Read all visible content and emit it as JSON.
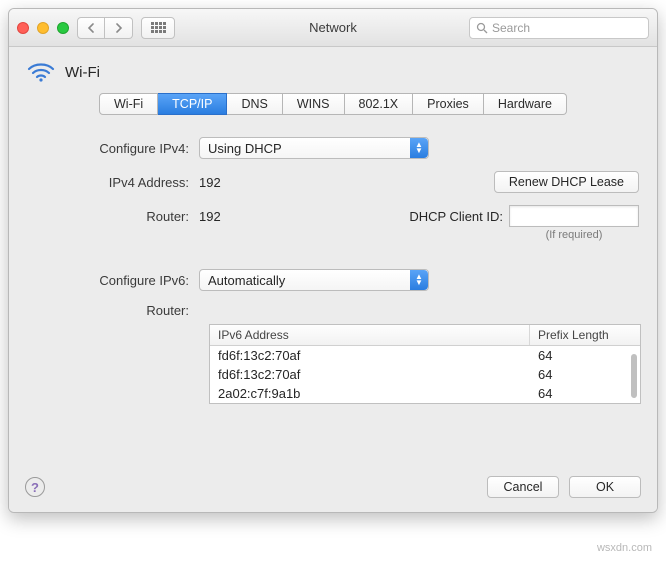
{
  "window": {
    "title": "Network"
  },
  "search": {
    "placeholder": "Search"
  },
  "header": {
    "interface_name": "Wi-Fi"
  },
  "tabs": [
    {
      "label": "Wi-Fi",
      "active": false
    },
    {
      "label": "TCP/IP",
      "active": true
    },
    {
      "label": "DNS",
      "active": false
    },
    {
      "label": "WINS",
      "active": false
    },
    {
      "label": "802.1X",
      "active": false
    },
    {
      "label": "Proxies",
      "active": false
    },
    {
      "label": "Hardware",
      "active": false
    }
  ],
  "ipv4": {
    "configure_label": "Configure IPv4:",
    "configure_value": "Using DHCP",
    "address_label": "IPv4 Address:",
    "address_value": "192",
    "router_label": "Router:",
    "router_value": "192",
    "renew_button": "Renew DHCP Lease",
    "dhcp_client_label": "DHCP Client ID:",
    "dhcp_client_value": "",
    "dhcp_hint": "(If required)"
  },
  "ipv6": {
    "configure_label": "Configure IPv6:",
    "configure_value": "Automatically",
    "router_label": "Router:",
    "router_value": "",
    "table": {
      "columns": {
        "address": "IPv6 Address",
        "prefix": "Prefix Length"
      },
      "rows": [
        {
          "address": "fd6f:13c2:70af",
          "prefix": "64"
        },
        {
          "address": "fd6f:13c2:70af",
          "prefix": "64"
        },
        {
          "address": "2a02:c7f:9a1b",
          "prefix": "64"
        }
      ]
    }
  },
  "footer": {
    "cancel": "Cancel",
    "ok": "OK"
  },
  "watermark": "wsxdn.com"
}
